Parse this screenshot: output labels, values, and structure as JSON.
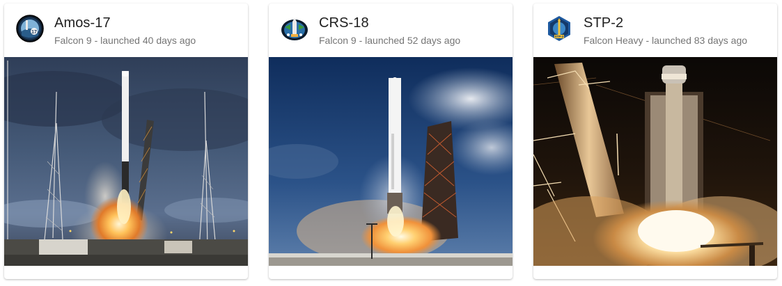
{
  "launches": [
    {
      "name": "Amos-17",
      "subtitle": "Falcon 9 - launched 40 days ago",
      "patch_icon": "amos-17-mission-patch-icon",
      "image": "falcon-9-launch-dusk-photo"
    },
    {
      "name": "CRS-18",
      "subtitle": "Falcon 9 - launched 52 days ago",
      "patch_icon": "crs-18-mission-patch-icon",
      "image": "falcon-9-dragon-launch-photo"
    },
    {
      "name": "STP-2",
      "subtitle": "Falcon Heavy - launched 83 days ago",
      "patch_icon": "stp-2-mission-patch-icon",
      "image": "falcon-heavy-night-launch-photo"
    }
  ]
}
